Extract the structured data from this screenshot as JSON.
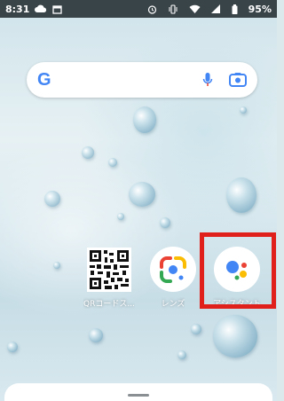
{
  "status_bar": {
    "time": "8:31",
    "left_icons": [
      "cloud-icon",
      "calendar-icon"
    ],
    "right_icons": [
      "alarm-icon",
      "vibrate-icon",
      "wifi-icon",
      "signal-icon",
      "battery-icon"
    ],
    "battery_percent": "95%"
  },
  "search_widget": {
    "logo": "G",
    "icons": [
      "mic-icon",
      "lens-camera-icon"
    ],
    "colors": {
      "blue": "#4285f4",
      "red": "#ea4335",
      "yellow": "#fbbc04",
      "green": "#34a853"
    }
  },
  "apps": [
    {
      "label": "QRコードス...",
      "icon": "qr-code-icon"
    },
    {
      "label": "レンズ",
      "icon": "google-lens-icon"
    },
    {
      "label": "アシスタント",
      "icon": "google-assistant-icon",
      "highlighted": true
    }
  ],
  "highlight_color": "#e0201b",
  "bottom_sheet": {
    "handle": "drag-handle"
  }
}
